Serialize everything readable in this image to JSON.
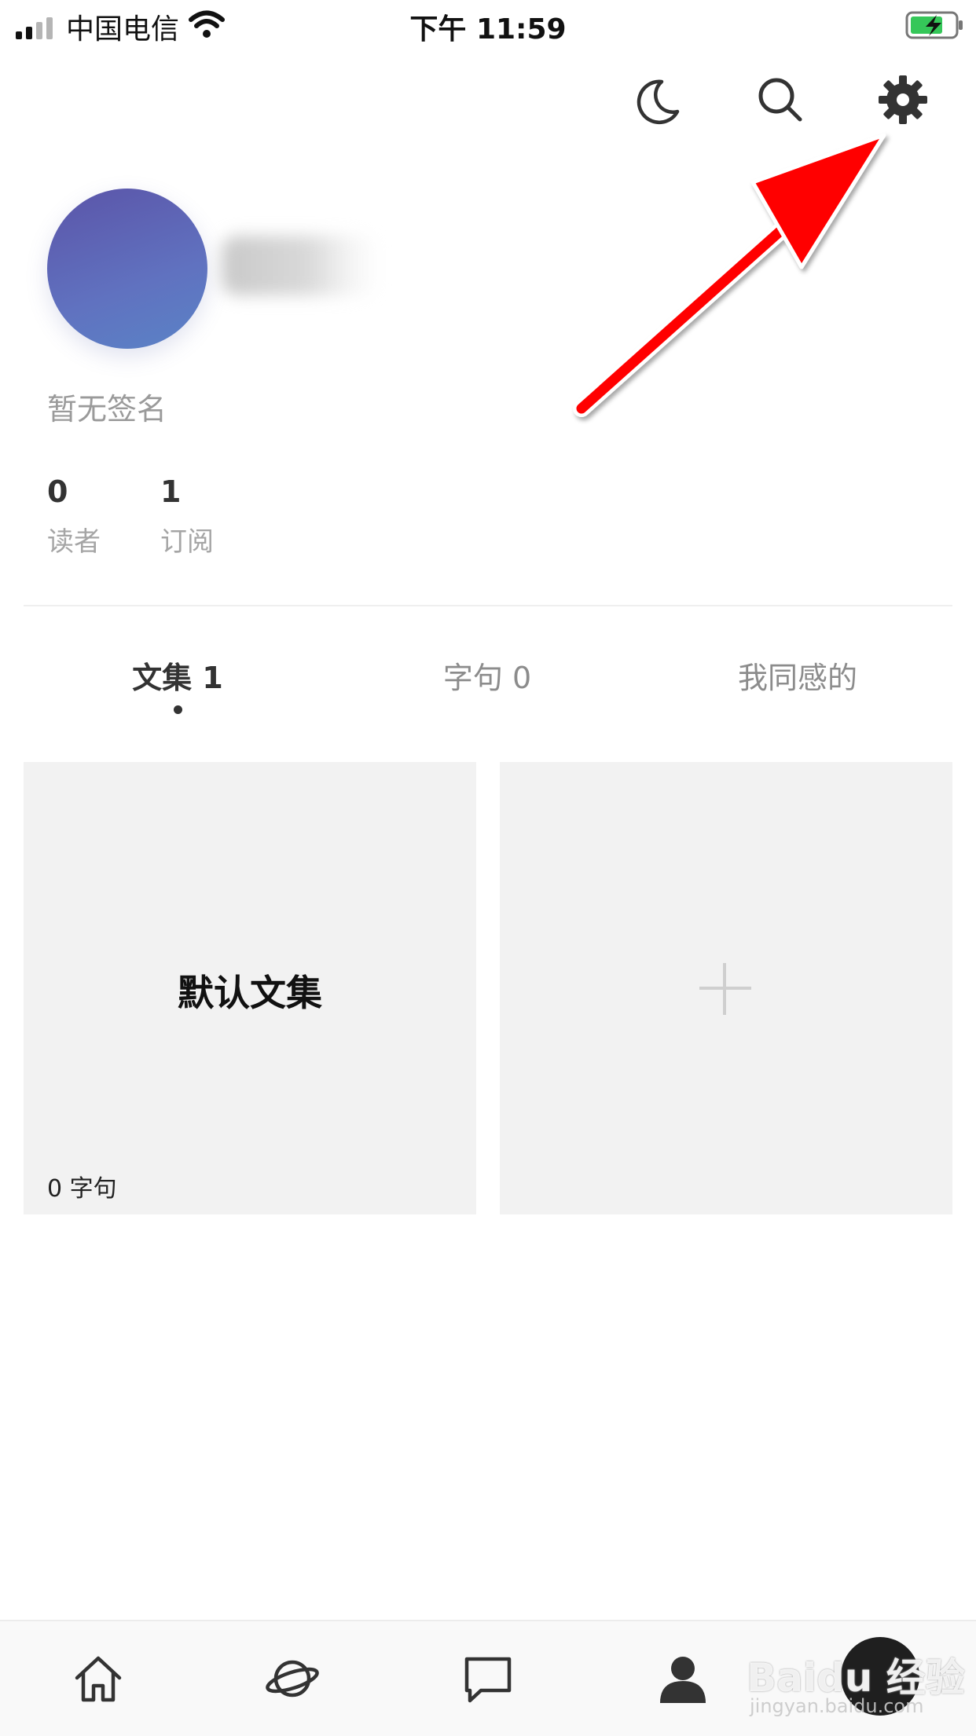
{
  "status_bar": {
    "carrier": "中国电信",
    "time": "下午 11:59"
  },
  "top_actions": {
    "icons": [
      "moon-icon",
      "search-icon",
      "gear-icon"
    ]
  },
  "profile": {
    "signature": "暂无签名",
    "stats": [
      {
        "value": "0",
        "label": "读者"
      },
      {
        "value": "1",
        "label": "订阅"
      }
    ]
  },
  "tabs": [
    {
      "label": "文集 1",
      "active": true
    },
    {
      "label": "字句 0",
      "active": false
    },
    {
      "label": "我同感的",
      "active": false
    }
  ],
  "collections": [
    {
      "title": "默认文集",
      "count": "0 字句"
    }
  ],
  "bottom_nav": {
    "items": [
      "home-icon",
      "discover-planet-icon",
      "message-icon",
      "profile-icon"
    ]
  },
  "watermark": {
    "text": "Baidu 经验",
    "url": "jingyan.baidu.com"
  },
  "colors": {
    "annotation_arrow": "#ff0000",
    "card_bg": "#f2f2f2",
    "avatar_gradient_start": "#5b54a8",
    "avatar_gradient_end": "#5a83c6"
  }
}
